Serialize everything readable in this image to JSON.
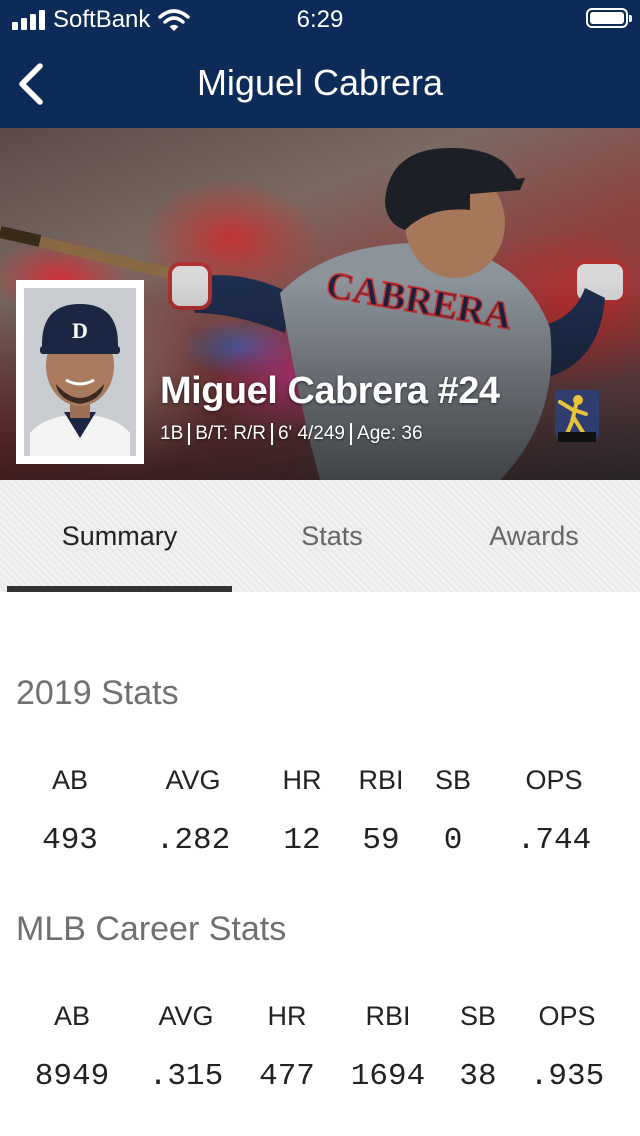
{
  "status_bar": {
    "carrier": "SoftBank",
    "time": "6:29"
  },
  "nav": {
    "title": "Miguel Cabrera",
    "back_icon": "chevron-left-icon"
  },
  "hero": {
    "name_number": "Miguel Cabrera #24",
    "position": "1B",
    "bats_throws": "B/T: R/R",
    "height_weight": "6' 4/249",
    "age": "Age: 36",
    "jersey_text": "CABRERA",
    "team_logo": "tigers-d-logo",
    "badge": "players-choice-logo"
  },
  "tabs": [
    {
      "label": "Summary",
      "active": true
    },
    {
      "label": "Stats",
      "active": false
    },
    {
      "label": "Awards",
      "active": false
    }
  ],
  "season_stats": {
    "title": "2019 Stats",
    "labels": [
      "AB",
      "AVG",
      "HR",
      "RBI",
      "SB",
      "OPS"
    ],
    "values": [
      "493",
      ".282",
      "12",
      "59",
      "0",
      ".744"
    ]
  },
  "career_stats": {
    "title": "MLB Career Stats",
    "labels": [
      "AB",
      "AVG",
      "HR",
      "RBI",
      "SB",
      "OPS"
    ],
    "values": [
      "8949",
      ".315",
      "477",
      "1694",
      "38",
      ".935"
    ]
  },
  "colors": {
    "navy": "#0c2b58",
    "text": "#222222",
    "muted": "#707070"
  }
}
